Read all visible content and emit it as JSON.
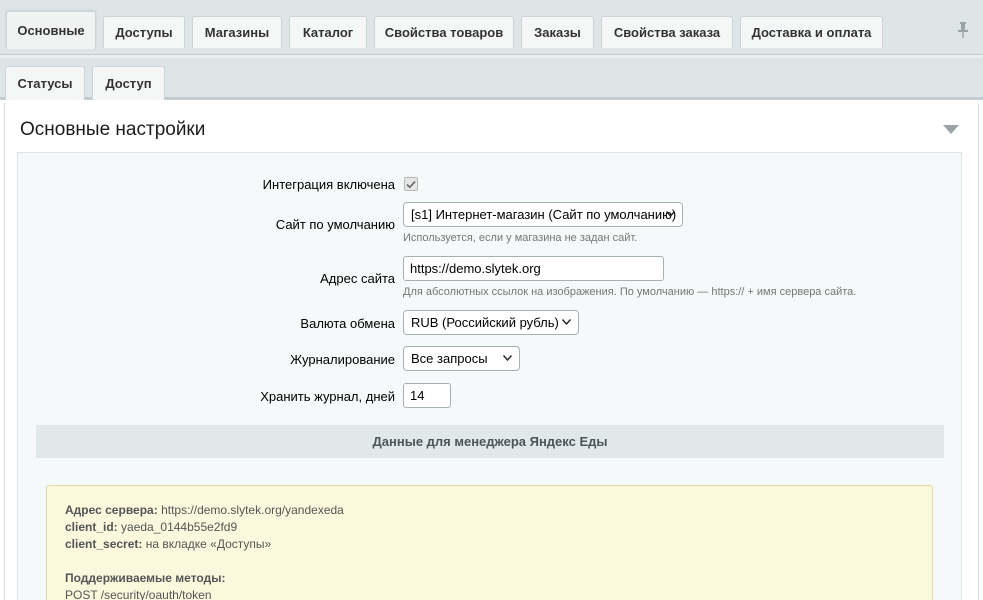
{
  "tabs": [
    {
      "label": "Основные",
      "active": true
    },
    {
      "label": "Доступы"
    },
    {
      "label": "Магазины"
    },
    {
      "label": "Каталог"
    },
    {
      "label": "Свойства товаров"
    },
    {
      "label": "Заказы"
    },
    {
      "label": "Свойства заказа"
    },
    {
      "label": "Доставка и оплата"
    }
  ],
  "subtabs": [
    {
      "label": "Статусы"
    },
    {
      "label": "Доступ"
    }
  ],
  "section": {
    "title": "Основные настройки"
  },
  "form": {
    "integration": {
      "label": "Интеграция включена",
      "checked": true
    },
    "default_site": {
      "label": "Сайт по умолчанию",
      "value": "[s1] Интернет-магазин (Сайт по умолчанию)",
      "hint": "Используется, если у магазина не задан сайт."
    },
    "site_address": {
      "label": "Адрес сайта",
      "value": "https://demo.slytek.org",
      "hint": "Для абсолютных ссылок на изображения. По умолчанию — https:// + имя сервера сайта."
    },
    "currency": {
      "label": "Валюта обмена",
      "value": "RUB (Российский рубль)"
    },
    "logging": {
      "label": "Журналирование",
      "value": "Все запросы"
    },
    "log_days": {
      "label": "Хранить журнал, дней",
      "value": "14"
    }
  },
  "manager": {
    "heading": "Данные для менеджера Яндекс Еды",
    "server_label": "Адрес сервера:",
    "server_value": "https://demo.slytek.org/yandexeda",
    "client_id_label": "client_id:",
    "client_id_value": "yaeda_0144b55e2fd9",
    "client_secret_label": "client_secret:",
    "client_secret_value": "на вкладке «Доступы»",
    "methods_label": "Поддерживаемые методы:",
    "methods": [
      "POST /security/oauth/token"
    ]
  },
  "icons": {
    "pin": "pin-icon",
    "collapse": "triangle-down-icon",
    "select": "chevron-down-icon",
    "check": "check-icon"
  }
}
